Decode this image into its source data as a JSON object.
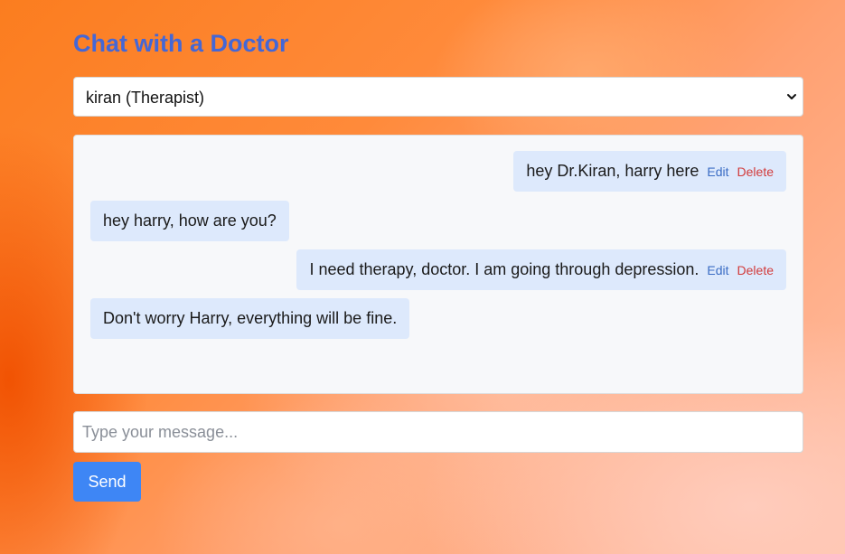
{
  "page": {
    "title": "Chat with a Doctor"
  },
  "doctor_select": {
    "selected": "kiran (Therapist)",
    "icon": "chevron-down-icon"
  },
  "messages": [
    {
      "sender": "user",
      "text": "hey Dr.Kiran, harry here",
      "edit_label": "Edit",
      "delete_label": "Delete"
    },
    {
      "sender": "doctor",
      "text": "hey harry, how are you?"
    },
    {
      "sender": "user",
      "text": "I need therapy, doctor. I am going through depression.",
      "edit_label": "Edit",
      "delete_label": "Delete"
    },
    {
      "sender": "doctor",
      "text": "Don't worry Harry, everything will be fine."
    }
  ],
  "composer": {
    "placeholder": "Type your message...",
    "value": "",
    "send_label": "Send"
  },
  "colors": {
    "title": "#4467d6",
    "bubble": "#dde9fc",
    "edit": "#3a6cc4",
    "delete": "#d23a3a",
    "send_button": "#3e86f5"
  }
}
